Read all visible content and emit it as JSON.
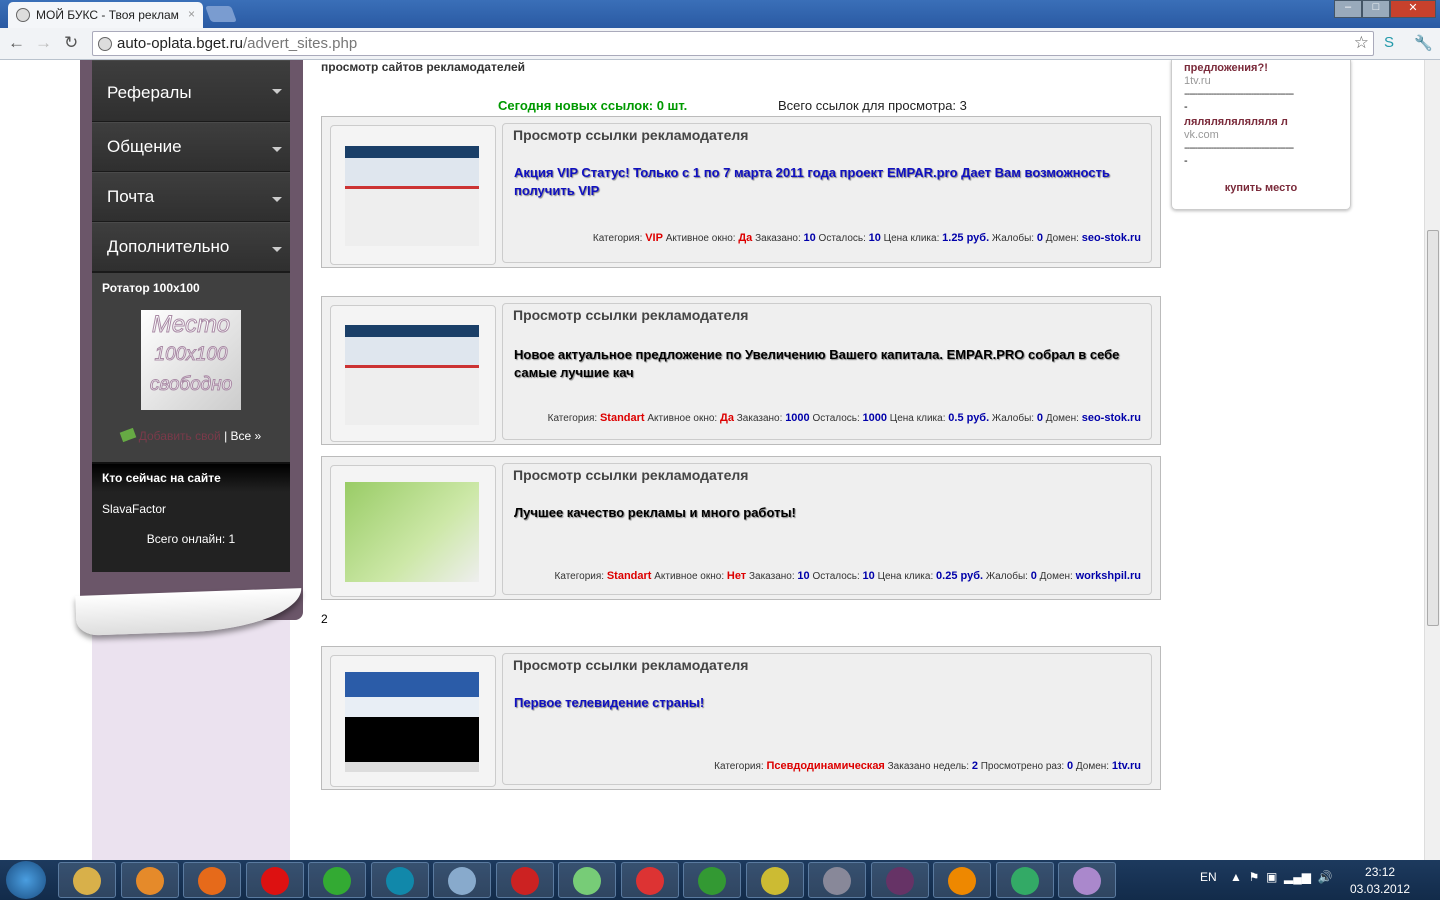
{
  "browser": {
    "tab_title": "МОЙ БУКС - Твоя реклам",
    "url_host": "auto-oplata.bget.ru",
    "url_path": "/advert_sites.php"
  },
  "sidebar": {
    "menu": [
      {
        "label": "Рефералы"
      },
      {
        "label": "Общение"
      },
      {
        "label": "Почта"
      },
      {
        "label": "Дополнительно"
      }
    ],
    "rotator": {
      "title": "Ротатор 100x100",
      "placeholder": [
        "Место",
        "100x100",
        "свободно"
      ],
      "add_link": "Добавить свой",
      "separator": "|",
      "all_link": "Все »"
    },
    "online": {
      "title": "Кто сейчас на сайте",
      "user": "SlavaFactor",
      "total": "Всего онлайн: 1"
    }
  },
  "main": {
    "title": "просмотр сайтов рекламодателей",
    "new_links": "Сегодня новых ссылок: 0 шт.",
    "total_links": "Всего ссылок для просмотра: 3",
    "page_number": "2",
    "cards": [
      {
        "heading": "Просмотр ссылки рекламодателя",
        "text": "Акция VIP Статус! Только с 1 по 7 марта 2011 года проект EMPAR.pro Дает Вам возможность получить VIP",
        "text_color": "#1010c0",
        "meta": [
          [
            "Категория: ",
            "VIP",
            "r"
          ],
          [
            " Активное окно: ",
            "Да",
            "r"
          ],
          [
            " Заказано: ",
            "10",
            "b"
          ],
          [
            " Осталось: ",
            "10",
            "b"
          ],
          [
            " Цена клика: ",
            "1.25 руб.",
            "b"
          ],
          [
            " Жалобы: ",
            "0",
            "b"
          ],
          [
            " Домен: ",
            "seo-stok.ru",
            "b"
          ]
        ]
      },
      {
        "heading": "Просмотр ссылки рекламодателя",
        "text": "Новое актуальное предложение по Увеличению Вашего капитала. EMPAR.PRO собрал в себе самые лучшие кач",
        "text_color": "#000000",
        "meta": [
          [
            "Категория: ",
            "Standart",
            "r"
          ],
          [
            " Активное окно: ",
            "Да",
            "r"
          ],
          [
            " Заказано: ",
            "1000",
            "b"
          ],
          [
            " Осталось: ",
            "1000",
            "b"
          ],
          [
            " Цена клика: ",
            "0.5 руб.",
            "b"
          ],
          [
            " Жалобы: ",
            "0",
            "b"
          ],
          [
            " Домен: ",
            "seo-stok.ru",
            "b"
          ]
        ]
      },
      {
        "heading": "Просмотр ссылки рекламодателя",
        "text": "Лучшее качество рекламы и много работы!",
        "text_color": "#000000",
        "meta": [
          [
            "Категория: ",
            "Standart",
            "r"
          ],
          [
            " Активное окно: ",
            "Нет",
            "r"
          ],
          [
            " Заказано: ",
            "10",
            "b"
          ],
          [
            " Осталось: ",
            "10",
            "b"
          ],
          [
            " Цена клика: ",
            "0.25 руб.",
            "b"
          ],
          [
            " Жалобы: ",
            "0",
            "b"
          ],
          [
            " Домен: ",
            "workshpil.ru",
            "b"
          ]
        ]
      },
      {
        "heading": "Просмотр ссылки рекламодателя",
        "text": "Первое телевидение страны!",
        "text_color": "#1010c0",
        "meta": [
          [
            "Категория: ",
            "Псевдодинамическая",
            "r"
          ],
          [
            " Заказано недель: ",
            "2",
            "b"
          ],
          [
            " Просмотрено раз: ",
            "0",
            "b"
          ],
          [
            " Домен: ",
            "1tv.ru",
            "b"
          ]
        ]
      }
    ]
  },
  "right_widget": {
    "items": [
      {
        "title": "предложения?!",
        "domain": "1tv.ru"
      },
      {
        "title": "ляляляляляляля л",
        "domain": "vk.com"
      }
    ],
    "separator": "-----------------------------------------",
    "dash": "-",
    "buy": "купить место"
  },
  "taskbar": {
    "lang": "EN",
    "time": "23:12",
    "date": "03.03.2012"
  }
}
